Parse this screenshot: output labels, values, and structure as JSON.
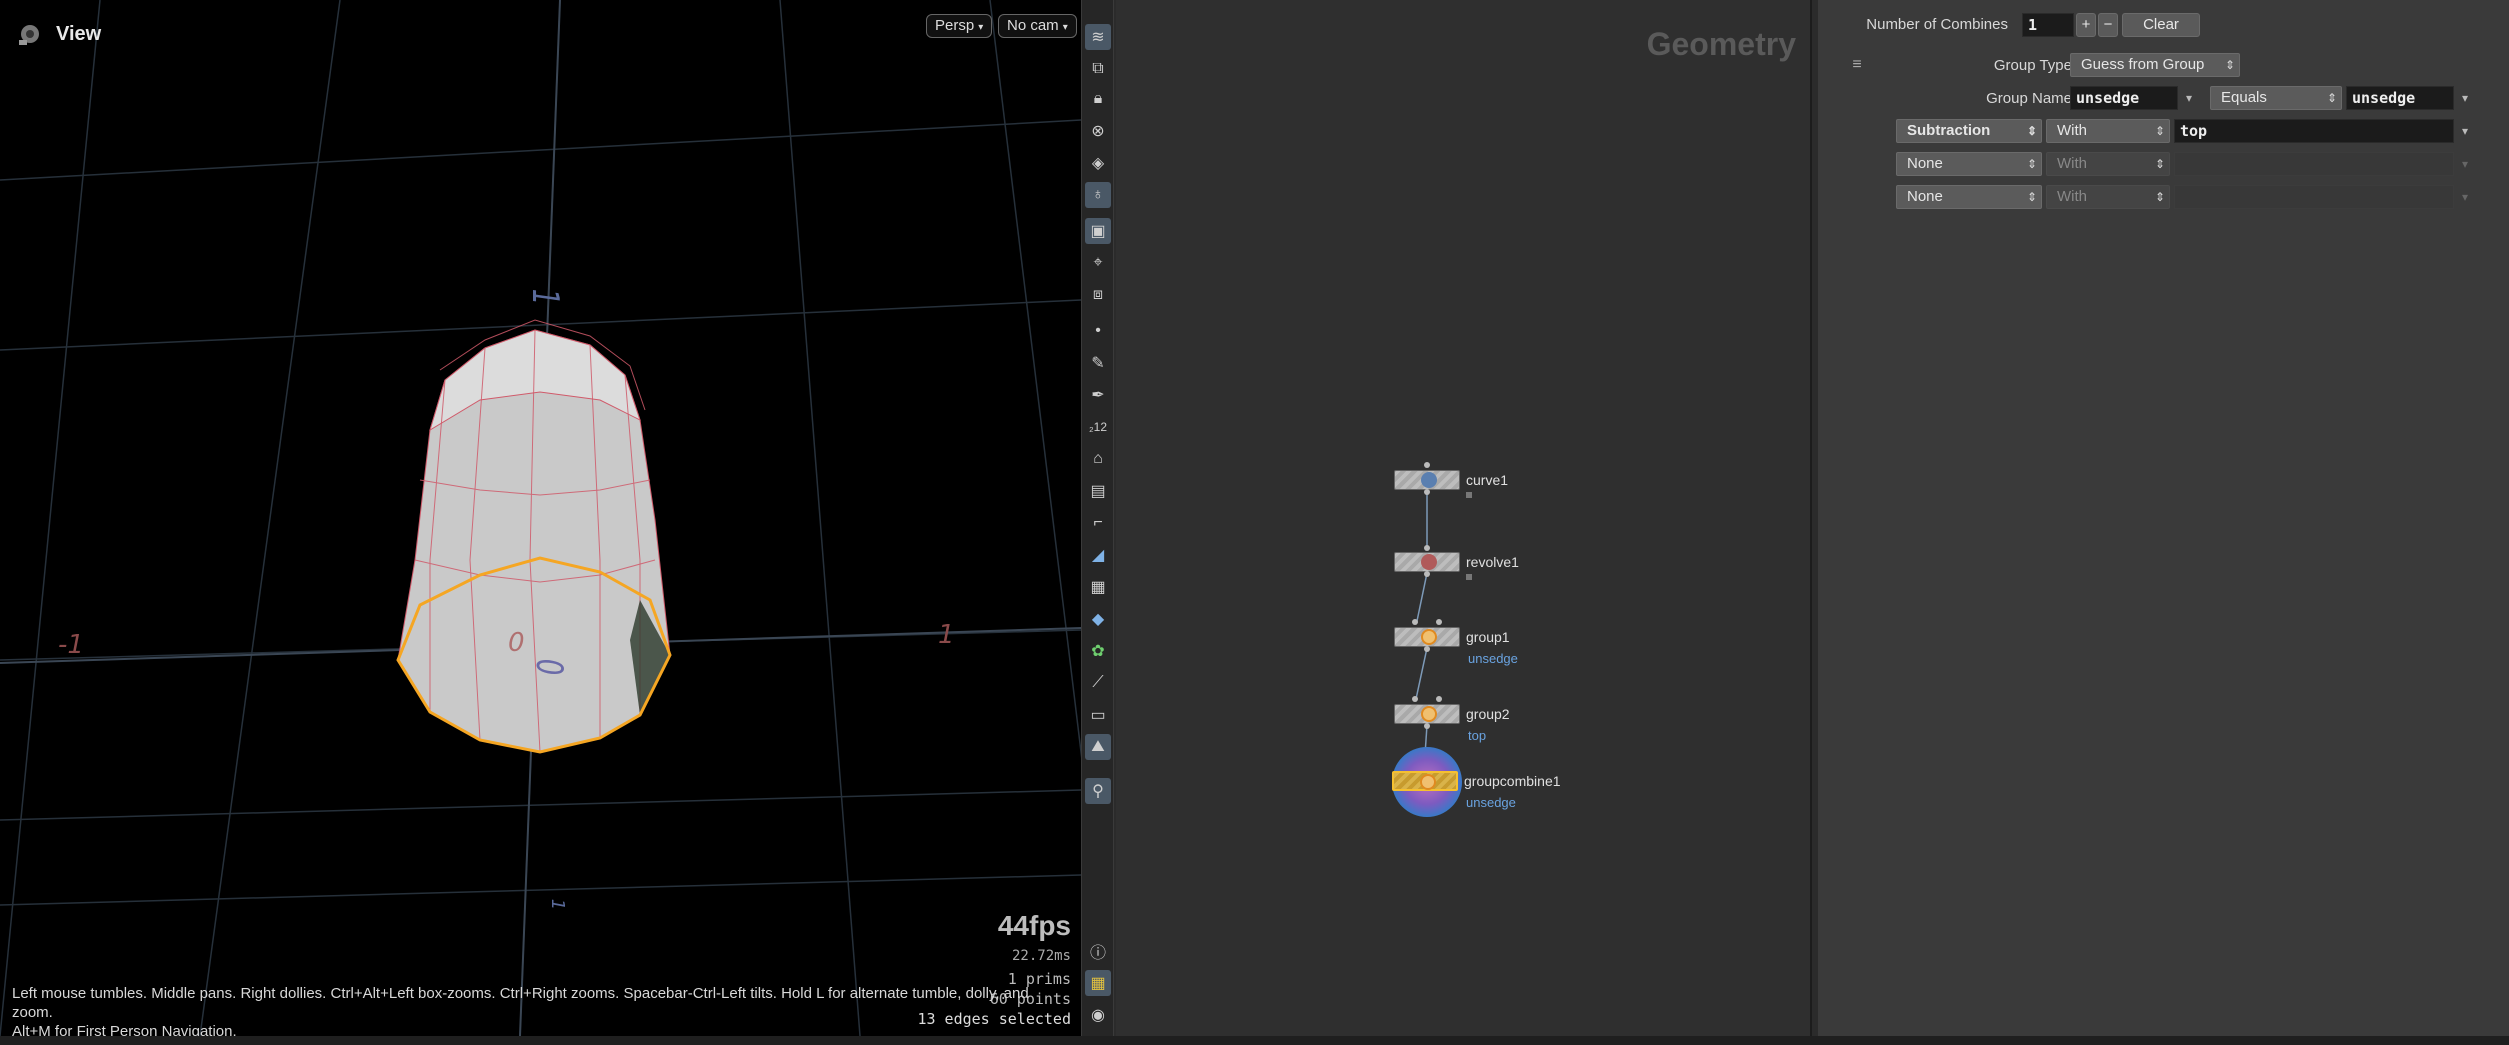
{
  "viewport": {
    "title": "View",
    "persp_label": "Persp",
    "cam_label": "No cam",
    "axis_labels": {
      "neg_x": "-1",
      "pos_x": "1",
      "origin_x": "0",
      "origin_z": "0",
      "top": "1",
      "bottom": "1"
    },
    "fps": "44fps",
    "frame_time": "22.72ms",
    "prims": "1  prims",
    "points": "60 points",
    "edges": "13 edges selected",
    "help_line1": "Left mouse tumbles. Middle pans. Right dollies. Ctrl+Alt+Left box-zooms. Ctrl+Right zooms. Spacebar-Ctrl-Left tilts. Hold L for alternate tumble, dolly, and zoom.",
    "help_line2": "Alt+M for First Person Navigation.",
    "colors": {
      "selection": "#f5a623",
      "wire": "#d05a6a"
    }
  },
  "toolbar_icons": [
    "layers-icon",
    "camera-view-icon",
    "lock-icon",
    "ghost-icon",
    "snap-icon",
    "light-icon",
    "display-options-icon",
    "select-mode-icon",
    "render-icon",
    "point-icon",
    "brush-icon",
    "pen-icon",
    "number-icon",
    "paint-icon",
    "stamp-icon",
    "measure-icon",
    "flatten-icon",
    "checker-icon",
    "uv-icon",
    "green-icon",
    "tool-icon",
    "box-icon",
    "background-icon",
    "pin-icon"
  ],
  "toolbar_bottom_icons": [
    "info-icon",
    "grid-layout-icon",
    "eye-icon"
  ],
  "network": {
    "context_title": "Geometry",
    "nodes": [
      {
        "name": "curve1",
        "sub": ""
      },
      {
        "name": "revolve1",
        "sub": ""
      },
      {
        "name": "group1",
        "sub": "unsedge"
      },
      {
        "name": "group2",
        "sub": "top"
      },
      {
        "name": "groupcombine1",
        "sub": "unsedge"
      }
    ]
  },
  "params": {
    "num_combines_label": "Number of Combines",
    "num_combines_value": "1",
    "plus": "+",
    "minus": "−",
    "clear": "Clear",
    "group_type_label": "Group Type",
    "group_type_value": "Guess from Group",
    "group_name_label": "Group Name",
    "group_name_value": "unsedge",
    "equals_label": "Equals",
    "equals_value": "unsedge",
    "rows": [
      {
        "op": "Subtraction",
        "with": "With",
        "value": "top"
      },
      {
        "op": "None",
        "with": "With",
        "value": ""
      },
      {
        "op": "None",
        "with": "With",
        "value": ""
      }
    ]
  }
}
